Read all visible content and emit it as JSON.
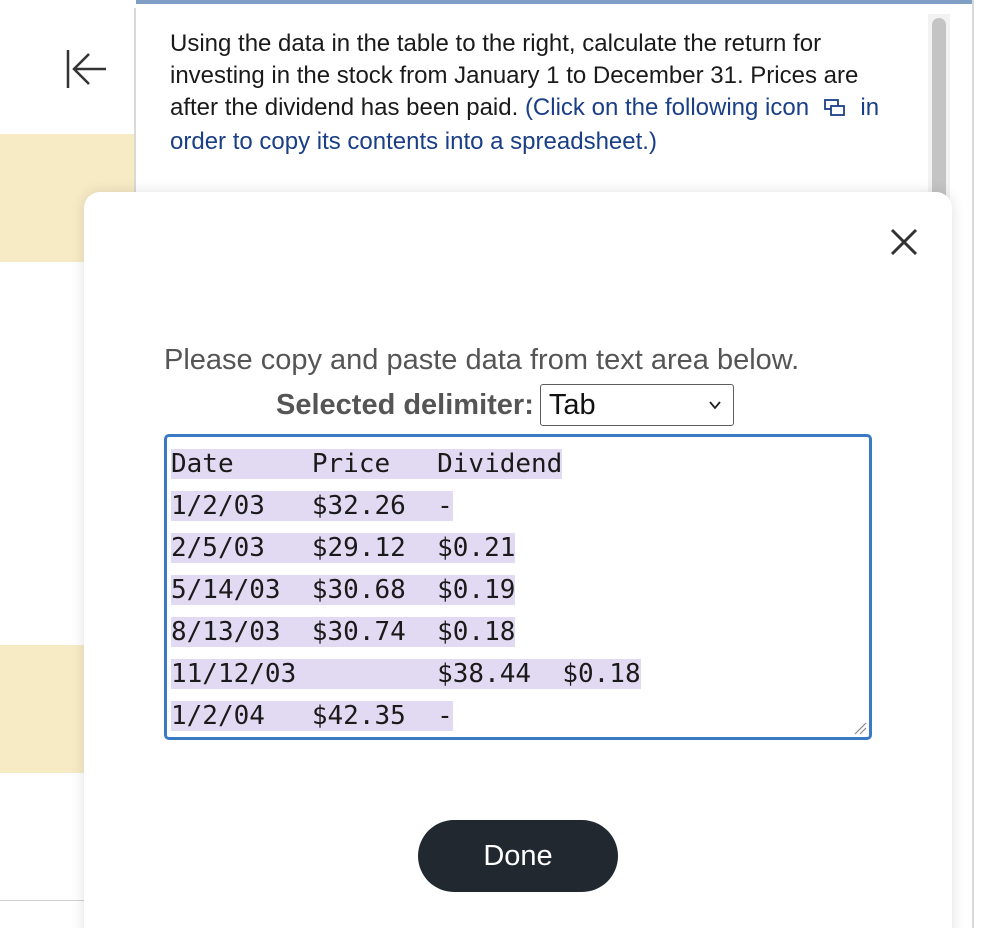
{
  "question": {
    "text": "Using the data in the table to the right, calculate the return for investing in the stock from January 1 to December 31. Prices are after the dividend has been paid.",
    "link_before_icon": "(Click on the following icon",
    "link_after_icon": "in order to copy its contents into a spreadsheet.)"
  },
  "modal": {
    "instruction": "Please copy and paste data from text area below.",
    "delimiter_label": "Selected delimiter:",
    "delimiter_value": "Tab",
    "done_label": "Done",
    "lines": [
      "Date     Price   Dividend",
      "1/2/03   $32.26  -",
      "2/5/03   $29.12  $0.21",
      "5/14/03  $30.68  $0.19",
      "8/13/03  $30.74  $0.18",
      "11/12/03         $38.44  $0.18",
      "1/2/04   $42.35  -"
    ]
  },
  "icons": {
    "collapse": "collapse-left-icon",
    "copy": "copy-icon",
    "close": "close-icon",
    "dropdown": "chevron-down-icon",
    "resize": "resize-grip-icon"
  },
  "colors": {
    "accent": "#3a7ac4",
    "highlight": "#e2daf3",
    "band": "#f7ebc6",
    "button": "#212830",
    "link": "#1a3f86"
  }
}
